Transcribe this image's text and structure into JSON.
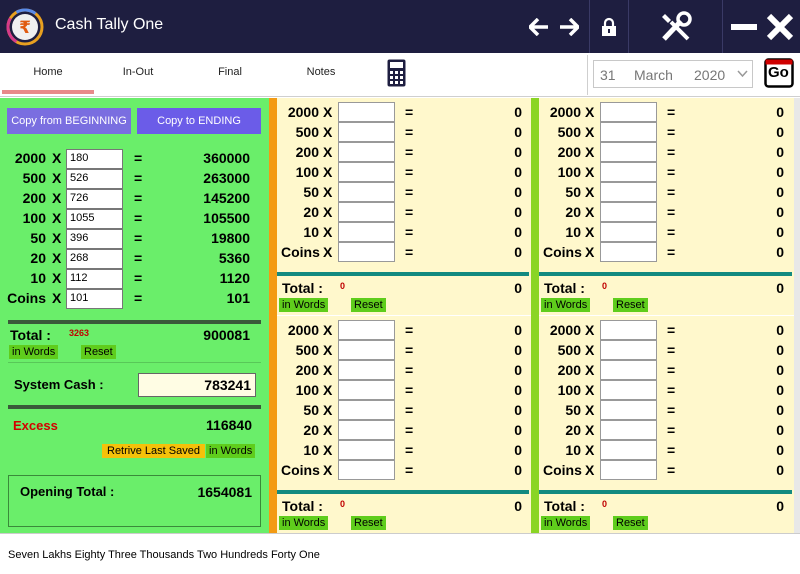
{
  "app": {
    "title": "Cash Tally One"
  },
  "tabs": [
    "Home",
    "In-Out",
    "Final",
    "Notes"
  ],
  "date": {
    "day": "31",
    "month": "March",
    "year": "2020",
    "go_label": "Go"
  },
  "left": {
    "copy_begin_label": "Copy from BEGINNING",
    "copy_end_label": "Copy to ENDING",
    "rows": [
      {
        "label": "2000",
        "x": "X",
        "count": "180",
        "eq": "=",
        "amount": "360000"
      },
      {
        "label": "500",
        "x": "X",
        "count": "526",
        "eq": "=",
        "amount": "263000"
      },
      {
        "label": "200",
        "x": "X",
        "count": "726",
        "eq": "=",
        "amount": "145200"
      },
      {
        "label": "100",
        "x": "X",
        "count": "1055",
        "eq": "=",
        "amount": "105500"
      },
      {
        "label": "50",
        "x": "X",
        "count": "396",
        "eq": "=",
        "amount": "19800"
      },
      {
        "label": "20",
        "x": "X",
        "count": "268",
        "eq": "=",
        "amount": "5360"
      },
      {
        "label": "10",
        "x": "X",
        "count": "112",
        "eq": "=",
        "amount": "1120"
      },
      {
        "label": "Coins",
        "x": "X",
        "count": "101",
        "eq": "=",
        "amount": "101"
      }
    ],
    "total_label": "Total :",
    "total_count": "3263",
    "total_value": "900081",
    "in_words_label": "in Words",
    "reset_label": "Reset",
    "system_cash_label": "System Cash :",
    "system_cash_value": "783241",
    "excess_label": "Excess",
    "excess_value": "116840",
    "retrive_label": "Retrive Last Saved",
    "in_words_label_2": "in Words",
    "opening_total_label": "Opening Total :",
    "opening_total_value": "1654081"
  },
  "panels": [
    {
      "rows": [
        {
          "label": "2000",
          "x": "X",
          "eq": "=",
          "amount": "0"
        },
        {
          "label": "500",
          "x": "X",
          "eq": "=",
          "amount": "0"
        },
        {
          "label": "200",
          "x": "X",
          "eq": "=",
          "amount": "0"
        },
        {
          "label": "100",
          "x": "X",
          "eq": "=",
          "amount": "0"
        },
        {
          "label": "50",
          "x": "X",
          "eq": "=",
          "amount": "0"
        },
        {
          "label": "20",
          "x": "X",
          "eq": "=",
          "amount": "0"
        },
        {
          "label": "10",
          "x": "X",
          "eq": "=",
          "amount": "0"
        },
        {
          "label": "Coins",
          "x": "X",
          "eq": "=",
          "amount": "0"
        }
      ],
      "total_label": "Total :",
      "total_count": "0",
      "total_value": "0",
      "in_words_label": "in Words",
      "reset_label": "Reset"
    },
    {
      "rows": [
        {
          "label": "2000",
          "x": "X",
          "eq": "=",
          "amount": "0"
        },
        {
          "label": "500",
          "x": "X",
          "eq": "=",
          "amount": "0"
        },
        {
          "label": "200",
          "x": "X",
          "eq": "=",
          "amount": "0"
        },
        {
          "label": "100",
          "x": "X",
          "eq": "=",
          "amount": "0"
        },
        {
          "label": "50",
          "x": "X",
          "eq": "=",
          "amount": "0"
        },
        {
          "label": "20",
          "x": "X",
          "eq": "=",
          "amount": "0"
        },
        {
          "label": "10",
          "x": "X",
          "eq": "=",
          "amount": "0"
        },
        {
          "label": "Coins",
          "x": "X",
          "eq": "=",
          "amount": "0"
        }
      ],
      "total_label": "Total :",
      "total_count": "0",
      "total_value": "0",
      "in_words_label": "in Words",
      "reset_label": "Reset"
    },
    {
      "rows": [
        {
          "label": "2000",
          "x": "X",
          "eq": "=",
          "amount": "0"
        },
        {
          "label": "500",
          "x": "X",
          "eq": "=",
          "amount": "0"
        },
        {
          "label": "200",
          "x": "X",
          "eq": "=",
          "amount": "0"
        },
        {
          "label": "100",
          "x": "X",
          "eq": "=",
          "amount": "0"
        },
        {
          "label": "50",
          "x": "X",
          "eq": "=",
          "amount": "0"
        },
        {
          "label": "20",
          "x": "X",
          "eq": "=",
          "amount": "0"
        },
        {
          "label": "10",
          "x": "X",
          "eq": "=",
          "amount": "0"
        },
        {
          "label": "Coins",
          "x": "X",
          "eq": "=",
          "amount": "0"
        }
      ],
      "total_label": "Total :",
      "total_count": "0",
      "total_value": "0",
      "in_words_label": "in Words",
      "reset_label": "Reset"
    },
    {
      "rows": [
        {
          "label": "2000",
          "x": "X",
          "eq": "=",
          "amount": "0"
        },
        {
          "label": "500",
          "x": "X",
          "eq": "=",
          "amount": "0"
        },
        {
          "label": "200",
          "x": "X",
          "eq": "=",
          "amount": "0"
        },
        {
          "label": "100",
          "x": "X",
          "eq": "=",
          "amount": "0"
        },
        {
          "label": "50",
          "x": "X",
          "eq": "=",
          "amount": "0"
        },
        {
          "label": "20",
          "x": "X",
          "eq": "=",
          "amount": "0"
        },
        {
          "label": "10",
          "x": "X",
          "eq": "=",
          "amount": "0"
        },
        {
          "label": "Coins",
          "x": "X",
          "eq": "=",
          "amount": "0"
        }
      ],
      "total_label": "Total :",
      "total_count": "0",
      "total_value": "0",
      "in_words_label": "in Words",
      "reset_label": "Reset"
    }
  ],
  "status": {
    "text": "Seven Lakhs Eighty Three Thousands Two Hundreds Forty One"
  },
  "colors": {
    "titlebar": "#1e1e40",
    "left_panel": "#6aee6a",
    "right_panel": "#fff8cc",
    "button_purple": "#6b5ce8",
    "accent_orange": "#f39a13",
    "accent_green": "#8ad524",
    "excess_red": "#d40000"
  },
  "icons": [
    "rupee-logo-icon",
    "arrow-left-icon",
    "arrow-right-icon",
    "lock-icon",
    "tools-icon",
    "minimize-icon",
    "close-icon",
    "calculator-icon",
    "go-icon",
    "chevron-down-icon"
  ]
}
